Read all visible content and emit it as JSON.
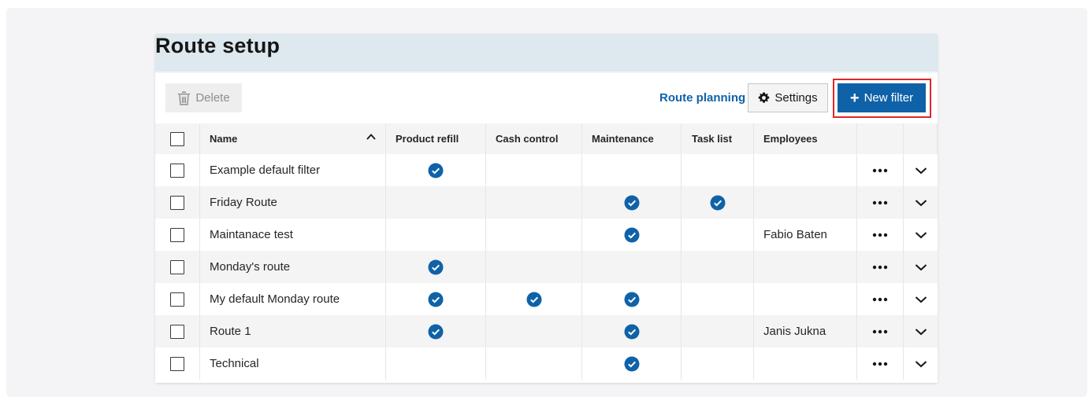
{
  "page": {
    "title": "Route setup"
  },
  "toolbar": {
    "delete_label": "Delete",
    "route_planning_label": "Route planning",
    "settings_label": "Settings",
    "new_filter_label": "New filter"
  },
  "colors": {
    "accent": "#0f62a8",
    "highlight": "#e0262b",
    "header_band": "#dde8ef"
  },
  "table": {
    "columns": {
      "name": "Name",
      "product_refill": "Product refill",
      "cash_control": "Cash control",
      "maintenance": "Maintenance",
      "task_list": "Task list",
      "employees": "Employees"
    },
    "sort": {
      "column": "name",
      "direction": "ascending"
    },
    "rows": [
      {
        "name": "Example default filter",
        "product_refill": true,
        "cash_control": false,
        "maintenance": false,
        "task_list": false,
        "employees": ""
      },
      {
        "name": "Friday Route",
        "product_refill": false,
        "cash_control": false,
        "maintenance": true,
        "task_list": true,
        "employees": ""
      },
      {
        "name": "Maintanace test",
        "product_refill": false,
        "cash_control": false,
        "maintenance": true,
        "task_list": false,
        "employees": "Fabio Baten"
      },
      {
        "name": "Monday's route",
        "product_refill": true,
        "cash_control": false,
        "maintenance": false,
        "task_list": false,
        "employees": ""
      },
      {
        "name": "My default Monday route",
        "product_refill": true,
        "cash_control": true,
        "maintenance": true,
        "task_list": false,
        "employees": ""
      },
      {
        "name": "Route 1",
        "product_refill": true,
        "cash_control": false,
        "maintenance": true,
        "task_list": false,
        "employees": "Janis Jukna"
      },
      {
        "name": "Technical",
        "product_refill": false,
        "cash_control": false,
        "maintenance": true,
        "task_list": false,
        "employees": ""
      }
    ]
  },
  "icons": {
    "delete": "trash-icon",
    "settings": "gear-icon",
    "new_filter": "plus-icon",
    "sort": "chevron-up-icon",
    "enabled": "check-circle-icon",
    "row_menu": "overflow-menu-icon",
    "row_expand": "chevron-down-icon"
  }
}
